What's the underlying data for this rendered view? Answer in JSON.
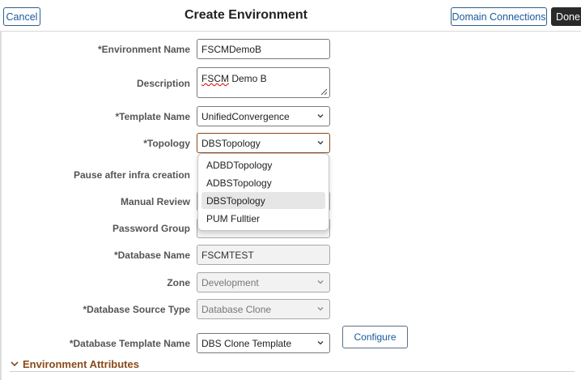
{
  "header": {
    "title": "Create Environment",
    "cancel_label": "Cancel",
    "domain_connections_label": "Domain Connections",
    "done_label": "Done"
  },
  "form": {
    "environment_name": {
      "label": "*Environment Name",
      "value": "FSCMDemoB"
    },
    "description": {
      "label": "Description",
      "value_word1": "FSCM",
      "value_rest": " Demo B"
    },
    "template_name": {
      "label": "*Template Name",
      "value": "UnifiedConvergence"
    },
    "topology": {
      "label": "*Topology",
      "value": "DBSTopology"
    },
    "pause_after_infra": {
      "label": "Pause after infra creation"
    },
    "manual_review": {
      "label": "Manual Review"
    },
    "password_group": {
      "label": "Password Group"
    },
    "database_name": {
      "label": "*Database Name",
      "value": "FSCMTEST"
    },
    "zone": {
      "label": "Zone",
      "value": "Development"
    },
    "database_source_type": {
      "label": "*Database Source Type",
      "value": "Database Clone"
    },
    "database_template_name": {
      "label": "*Database Template Name",
      "value": "DBS Clone Template"
    },
    "configure_label": "Configure"
  },
  "topology_dropdown": {
    "options": [
      "ADBDTopology",
      "ADBSTopology",
      "DBSTopology",
      "PUM Fulltier"
    ],
    "selected": "DBSTopology"
  },
  "section": {
    "title": "Environment Attributes"
  },
  "colors": {
    "accent_link": "#1a5aa0",
    "section_title": "#8a4a1a",
    "done_bg": "#2a2a2a"
  }
}
